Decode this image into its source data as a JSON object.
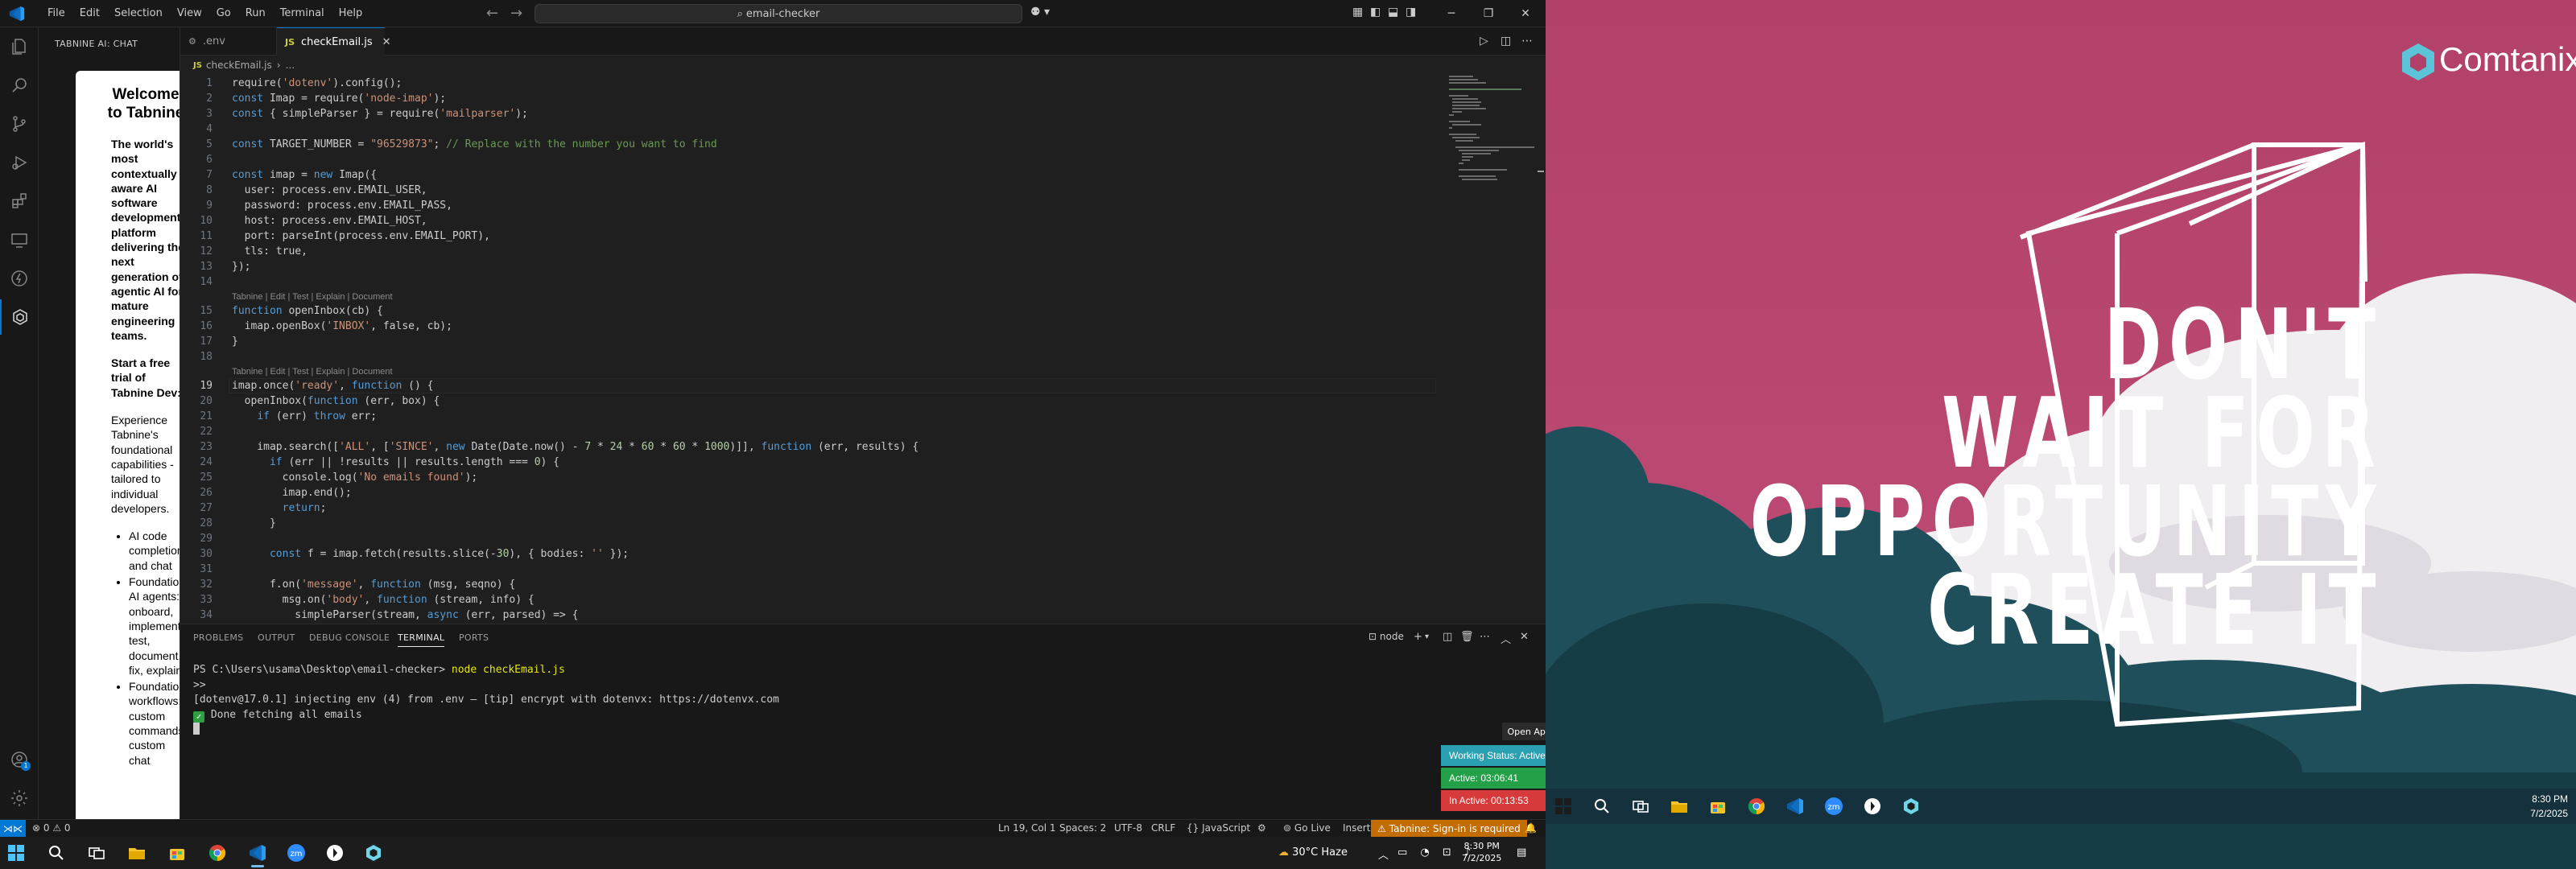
{
  "window": {
    "menu": [
      "File",
      "Edit",
      "Selection",
      "View",
      "Go",
      "Run",
      "Terminal",
      "Help"
    ],
    "search_text": "email-checker"
  },
  "sidebar": {
    "title": "TABNINE AI: CHAT",
    "welcome": "Welcome to Tabnine",
    "lead": "The world's most contextually aware AI software development platform delivering the next generation of agentic AI for mature engineering teams.",
    "trial": "Start a free trial of Tabnine Dev:",
    "para": "Experience Tabnine's foundational capabilities - tailored to individual developers.",
    "bullets": [
      "AI code completions and chat",
      "Foundational AI agents: onboard, implement, test, document, fix, explain",
      "Foundational workflows: custom commands, custom chat"
    ]
  },
  "tabs": [
    {
      "label": ".env",
      "icon": "⚙",
      "active": false
    },
    {
      "label": "checkEmail.js",
      "icon": "JS",
      "active": true
    }
  ],
  "breadcrumb": {
    "file": "checkEmail.js",
    "more": "..."
  },
  "codelens": "Tabnine | Edit | Test | Explain | Document",
  "code": [
    {
      "n": "1",
      "t": "require('dotenv').config();"
    },
    {
      "n": "2",
      "t": "const Imap = require('node-imap');"
    },
    {
      "n": "3",
      "t": "const { simpleParser } = require('mailparser');"
    },
    {
      "n": "4",
      "t": ""
    },
    {
      "n": "5",
      "t": "const TARGET_NUMBER = \"96529873\"; // Replace with the number you want to find"
    },
    {
      "n": "6",
      "t": ""
    },
    {
      "n": "7",
      "t": "const imap = new Imap({"
    },
    {
      "n": "8",
      "t": "  user: process.env.EMAIL_USER,"
    },
    {
      "n": "9",
      "t": "  password: process.env.EMAIL_PASS,"
    },
    {
      "n": "10",
      "t": "  host: process.env.EMAIL_HOST,"
    },
    {
      "n": "11",
      "t": "  port: parseInt(process.env.EMAIL_PORT),"
    },
    {
      "n": "12",
      "t": "  tls: true,"
    },
    {
      "n": "13",
      "t": "});"
    },
    {
      "n": "14",
      "t": ""
    },
    {
      "n": "15",
      "t": "function openInbox(cb) {"
    },
    {
      "n": "16",
      "t": "  imap.openBox('INBOX', false, cb);"
    },
    {
      "n": "17",
      "t": "}"
    },
    {
      "n": "18",
      "t": ""
    },
    {
      "n": "19",
      "t": "imap.once('ready', function () {"
    },
    {
      "n": "20",
      "t": "  openInbox(function (err, box) {"
    },
    {
      "n": "21",
      "t": "    if (err) throw err;"
    },
    {
      "n": "22",
      "t": ""
    },
    {
      "n": "23",
      "t": "    imap.search(['ALL', ['SINCE', new Date(Date.now() - 7 * 24 * 60 * 60 * 1000)]], function (err, results) {"
    },
    {
      "n": "24",
      "t": "      if (err || !results || results.length === 0) {"
    },
    {
      "n": "25",
      "t": "        console.log('No emails found');"
    },
    {
      "n": "26",
      "t": "        imap.end();"
    },
    {
      "n": "27",
      "t": "        return;"
    },
    {
      "n": "28",
      "t": "      }"
    },
    {
      "n": "29",
      "t": ""
    },
    {
      "n": "30",
      "t": "      const f = imap.fetch(results.slice(-30), { bodies: '' });"
    },
    {
      "n": "31",
      "t": ""
    },
    {
      "n": "32",
      "t": "      f.on('message', function (msg, seqno) {"
    },
    {
      "n": "33",
      "t": "        msg.on('body', function (stream, info) {"
    },
    {
      "n": "34",
      "t": "          simpleParser(stream, async (err, parsed) => {"
    }
  ],
  "panel": {
    "tabs": [
      "PROBLEMS",
      "OUTPUT",
      "DEBUG CONSOLE",
      "TERMINAL",
      "PORTS"
    ],
    "terminal_name": "node"
  },
  "terminal": {
    "prompt": "PS C:\\Users\\usama\\Desktop\\email-checker>",
    "command": "node checkEmail.js",
    "line2": ">>",
    "line3": "[dotenv@17.0.1] injecting env (4) from .env – [tip] encrypt with dotenvx: https://dotenvx.com",
    "line4": "Done fetching all emails"
  },
  "statusbar": {
    "problems": "⊗ 0 ⚠ 0",
    "position": "Ln 19, Col 1",
    "spaces": "Spaces: 2",
    "encoding": "UTF-8",
    "eol": "CRLF",
    "language": "JavaScript",
    "golive": "Go Live",
    "insert": "Insert",
    "tabnine": "Tabnine: Sign-in is required"
  },
  "tracker": {
    "open_app": "Open App ↗",
    "working": "Working Status: Active",
    "active": "Active: 03:06:41",
    "inactive": "In Active: 00:13:53",
    "colors": {
      "working": "#2aa0b2",
      "active": "#24a148",
      "inactive": "#d63a3a"
    }
  },
  "taskbar_left": {
    "weather": "30°C  Haze",
    "time": "8:30 PM",
    "date": "7/2/2025"
  },
  "desktop": {
    "brand": "Comtanix",
    "poster": [
      "DON'T",
      "WAIT FOR",
      "OPPORTUNITY",
      "CREATE IT"
    ],
    "time": "8:30 PM",
    "date": "7/2/2025"
  }
}
